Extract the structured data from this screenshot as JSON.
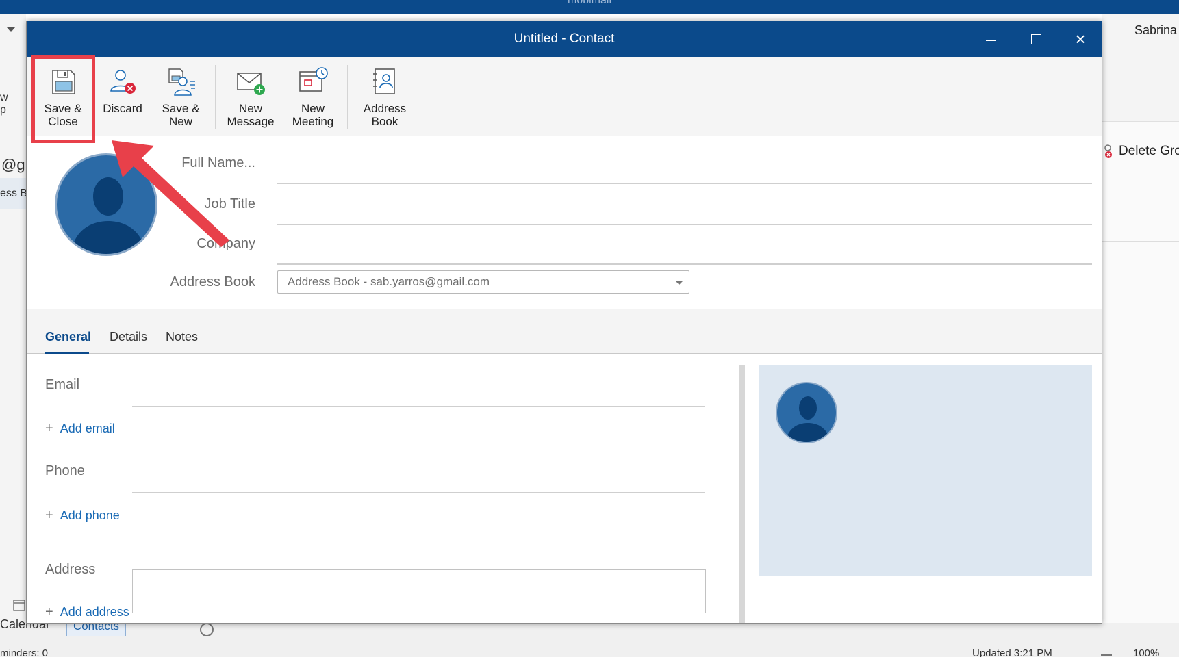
{
  "background": {
    "app_title": "mobimail",
    "user_name": "Sabrina",
    "left_fragments": [
      "w",
      "p",
      "@g",
      "ess B"
    ],
    "delete_group_label": "Delete Gro",
    "status_left": "minders: 0",
    "status_updated": "Updated 3:21 PM",
    "zoom": "100%",
    "nav_calendar": "Calendar",
    "nav_contacts": "Contacts"
  },
  "dialog": {
    "title": "Untitled - Contact",
    "window_controls": {
      "minimize": "minimize-icon",
      "maximize": "maximize-icon",
      "close": "×"
    }
  },
  "ribbon": {
    "save_close": "Save &\nClose",
    "discard": "Discard",
    "save_new": "Save &\nNew",
    "new_message": "New\nMessage",
    "new_meeting": "New\nMeeting",
    "address_book": "Address\nBook"
  },
  "identity": {
    "full_name_label": "Full Name...",
    "job_title_label": "Job Title",
    "company_label": "Company",
    "address_book_label": "Address Book",
    "address_book_value": "Address Book - sab.yarros@gmail.com"
  },
  "tabs": [
    {
      "label": "General",
      "active": true
    },
    {
      "label": "Details",
      "active": false
    },
    {
      "label": "Notes",
      "active": false
    }
  ],
  "general": {
    "email_label": "Email",
    "add_email": "Add email",
    "phone_label": "Phone",
    "add_phone": "Add phone",
    "address_label": "Address",
    "add_address": "Add address"
  },
  "colors": {
    "title_bar": "#0b4a8b",
    "accent": "#0b4a8b",
    "link": "#1b6bb5",
    "highlight": "#e8404a",
    "avatar": "#2b6aa6",
    "preview_bg": "#dde7f1"
  }
}
